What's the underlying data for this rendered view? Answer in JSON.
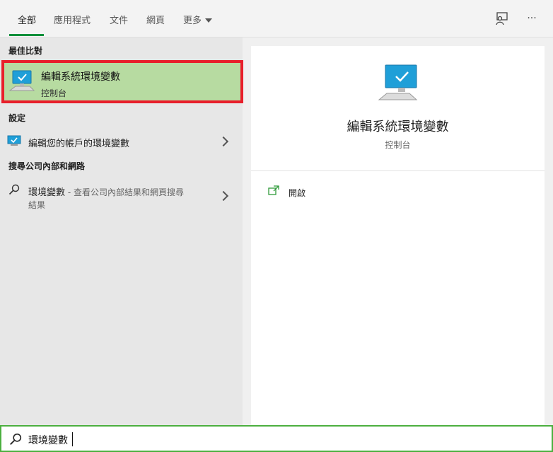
{
  "tabs": [
    {
      "label": "全部"
    },
    {
      "label": "應用程式"
    },
    {
      "label": "文件"
    },
    {
      "label": "網頁"
    },
    {
      "label": "更多"
    }
  ],
  "icons": {
    "feedback": "feedback-person-icon",
    "more": "ellipsis-icon"
  },
  "more_label": "···",
  "sections": {
    "best_match": "最佳比對",
    "settings": "設定",
    "intranet": "搜尋公司內部和網路"
  },
  "best_match": {
    "title": "編輯系統環境變數",
    "subtitle": "控制台"
  },
  "settings_item": {
    "label": "編輯您的帳戶的環境變數"
  },
  "intranet_item": {
    "query": "環境變數",
    "description_1": " - 查看公司內部結果和網頁搜尋",
    "description_2": "結果"
  },
  "preview": {
    "title": "編輯系統環境變數",
    "subtitle": "控制台",
    "open_label": "開啟"
  },
  "search": {
    "value": "環境變數"
  },
  "colors": {
    "accent": "#0a8f3a",
    "highlight": "#b7dba1",
    "outline": "#e81f2b",
    "search_border": "#4caf3f"
  }
}
